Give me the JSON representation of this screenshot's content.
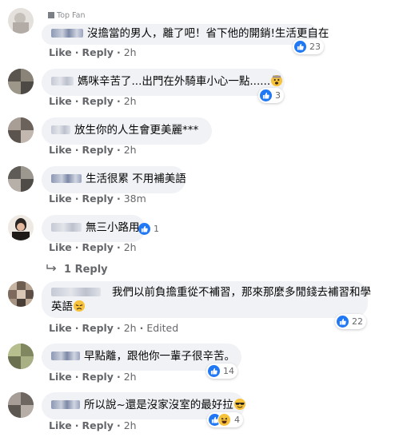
{
  "badge": {
    "label": "Top Fan",
    "icon": "top-fan-badge-icon"
  },
  "actions": {
    "like": "Like",
    "reply": "Reply",
    "separator": "·"
  },
  "comments": [
    {
      "text": "沒擔當的男人，離了吧！省下他的開銷!生活更自在",
      "time": "2h",
      "edited": "",
      "reactions": {
        "types": [
          "like"
        ],
        "count": "23"
      }
    },
    {
      "text": "媽咪辛苦了...出門在外騎車小心一點......",
      "time": "2h",
      "edited": "",
      "reactions": {
        "types": [
          "like"
        ],
        "count": "3"
      }
    },
    {
      "text": "放生你的人生會更美麗***",
      "time": "2h",
      "edited": "",
      "reactions": {
        "types": [],
        "count": ""
      }
    },
    {
      "text": "生活很累 不用補美語",
      "time": "38m",
      "edited": "",
      "reactions": {
        "types": [],
        "count": ""
      }
    },
    {
      "text": "無三小路用",
      "time": "2h",
      "edited": "",
      "reactions": {
        "types": [
          "like"
        ],
        "count": "1"
      },
      "replies_label": "1 Reply"
    },
    {
      "text_line1": "我們以前負擔重從不補習，那來那麼多閒錢去補習和學",
      "text_line2": "英語",
      "time": "2h",
      "edited": "Edited",
      "reactions": {
        "types": [
          "like"
        ],
        "count": "22"
      }
    },
    {
      "text": "早點離，跟他你一輩子很辛苦。",
      "time": "2h",
      "edited": "",
      "reactions": {
        "types": [
          "like"
        ],
        "count": "14"
      }
    },
    {
      "text": "所以說~還是沒家沒室的最好拉",
      "time": "2h",
      "edited": "",
      "reactions": {
        "types": [
          "like",
          "laugh"
        ],
        "count": "4"
      }
    }
  ],
  "colors": {
    "bubble": "#f0f2f5",
    "text": "#050505",
    "secondary": "#65676b",
    "like_blue": "#2078f4",
    "emoji_yellow": "#f7c33c"
  }
}
